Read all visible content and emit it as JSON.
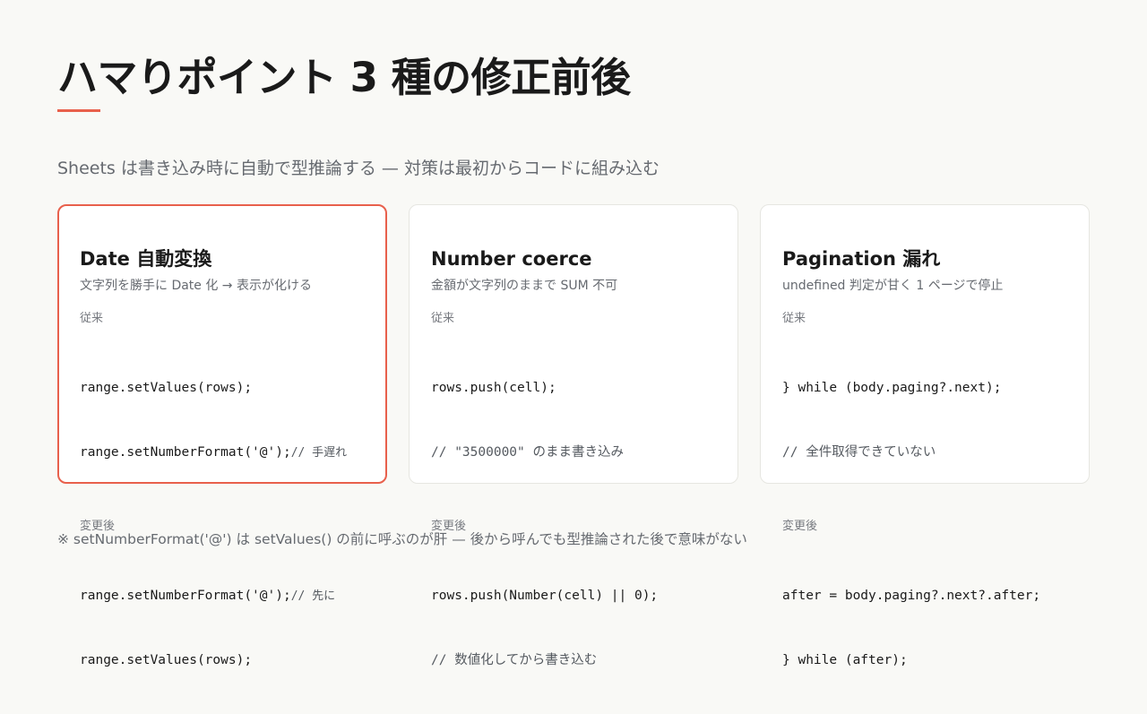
{
  "header": {
    "title": "ハマりポイント 3 種の修正前後",
    "subtitle": "Sheets は書き込み時に自動で型推論する — 対策は最初からコードに組み込む"
  },
  "colors": {
    "accent": "#e8604c",
    "background": "#f9f9f6",
    "card": "#ffffff"
  },
  "cards": [
    {
      "title": "Date 自動変換",
      "description": "文字列を勝手に Date 化 → 表示が化ける",
      "before_label": "従来",
      "before_lines": [
        {
          "code": "range.setValues(rows);",
          "comment": ""
        },
        {
          "code": "range.setNumberFormat('@');",
          "comment": "// 手遅れ"
        }
      ],
      "after_label": "変更後",
      "after_lines": [
        {
          "code": "range.setNumberFormat('@');",
          "comment": "// 先に"
        },
        {
          "code": "range.setValues(rows);",
          "comment": ""
        }
      ]
    },
    {
      "title": "Number coerce",
      "description": "金額が文字列のままで SUM 不可",
      "before_label": "従来",
      "before_lines": [
        {
          "code": "rows.push(cell);",
          "comment": ""
        },
        {
          "code": "",
          "comment": "// \"3500000\" のまま書き込み"
        }
      ],
      "after_label": "変更後",
      "after_lines": [
        {
          "code": "rows.push(Number(cell) || 0);",
          "comment": ""
        },
        {
          "code": "",
          "comment": "// 数値化してから書き込む"
        }
      ]
    },
    {
      "title": "Pagination 漏れ",
      "description": "undefined 判定が甘く 1 ページで停止",
      "before_label": "従来",
      "before_lines": [
        {
          "code": "} while (body.paging?.next);",
          "comment": ""
        },
        {
          "code": "",
          "comment": "// 全件取得できていない"
        }
      ],
      "after_label": "変更後",
      "after_lines": [
        {
          "code": "after = body.paging?.next?.after;",
          "comment": ""
        },
        {
          "code": "} while (after);",
          "comment": ""
        }
      ]
    }
  ],
  "footnote": "※ setNumberFormat('@') は setValues() の前に呼ぶのが肝 — 後から呼んでも型推論された後で意味がない"
}
